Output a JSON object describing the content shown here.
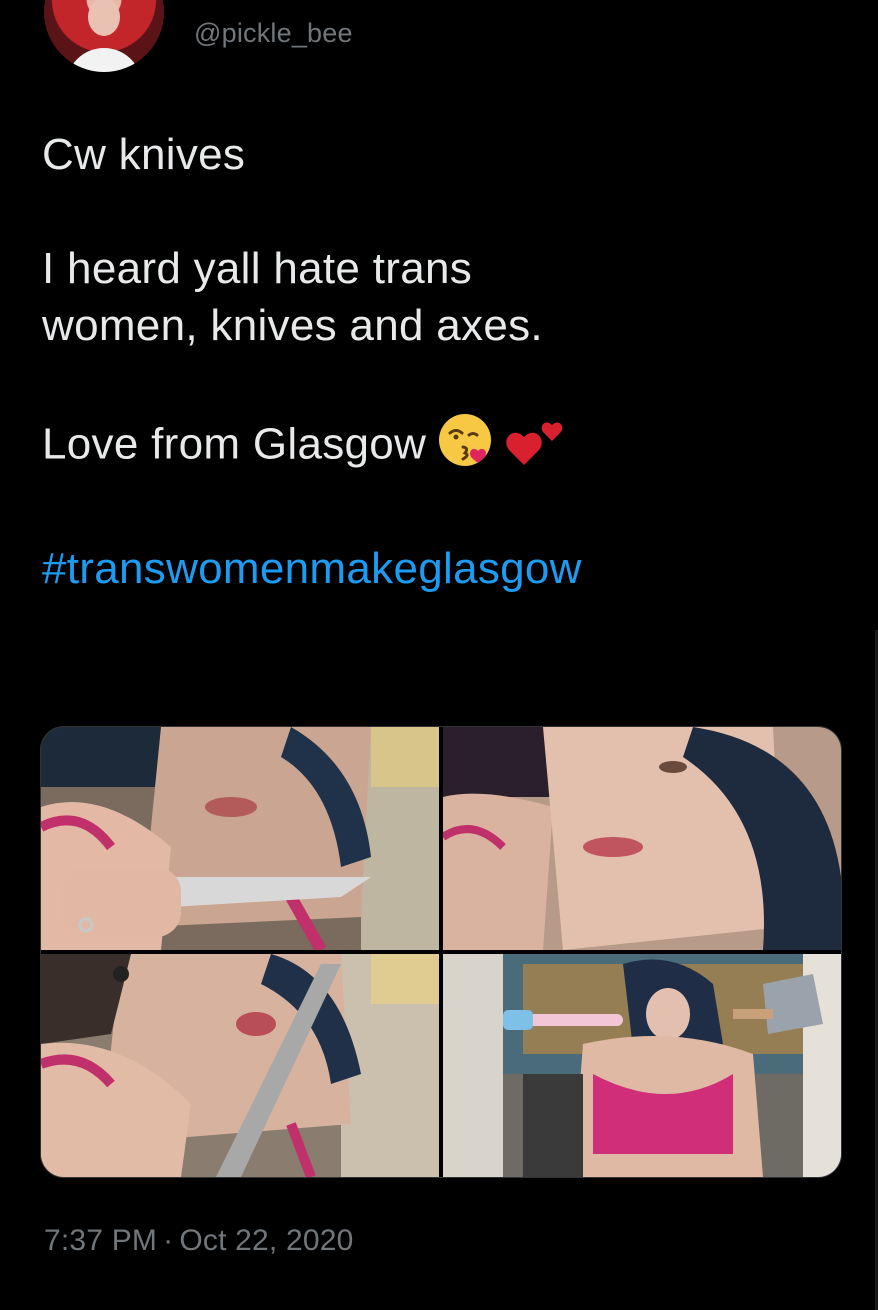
{
  "tweet": {
    "handle": "@pickle_bee",
    "lines": {
      "cw": "Cw knives",
      "line1": "I heard yall hate trans",
      "line2": "women, knives and axes.",
      "love": "Love from Glasgow",
      "hashtag": "#transwomenmakeglasgow"
    },
    "time": "7:37 PM",
    "separator": "·",
    "date": "Oct 22, 2020"
  },
  "media": {
    "count": 4,
    "items": [
      {
        "icon": "photo-knife-selfie"
      },
      {
        "icon": "photo-closeup-selfie"
      },
      {
        "icon": "photo-kissing-knife"
      },
      {
        "icon": "photo-axe-pose"
      }
    ]
  },
  "colors": {
    "background": "#000000",
    "text": "#e7e9ea",
    "secondary": "#71767b",
    "link": "#1d9bf0"
  },
  "icons": {
    "emoji1": "kissing-face-emoji",
    "emoji2": "two-hearts-emoji"
  }
}
